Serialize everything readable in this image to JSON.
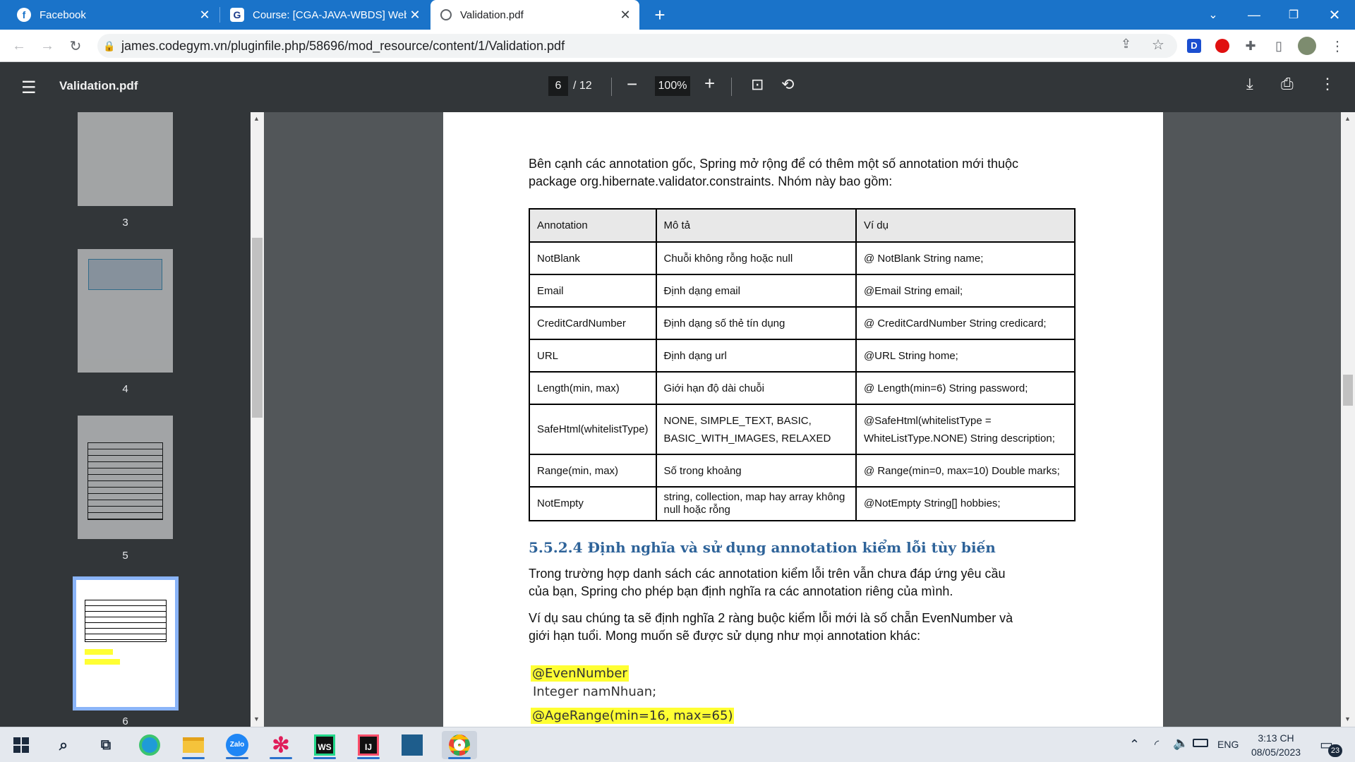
{
  "tabs": [
    {
      "title": "Facebook",
      "icon": "facebook-icon"
    },
    {
      "title": "Course: [CGA-JAVA-WBDS] Web |",
      "icon": "codegym-icon"
    },
    {
      "title": "Validation.pdf",
      "icon": "globe-icon"
    }
  ],
  "address": {
    "url": "james.codegym.vn/pluginfile.php/58696/mod_resource/content/1/Validation.pdf"
  },
  "pdf_toolbar": {
    "title": "Validation.pdf",
    "current_page": "6",
    "total_pages": "/ 12",
    "zoom": "100%"
  },
  "sidebar": {
    "thumbnails": [
      {
        "label": "3"
      },
      {
        "label": "4"
      },
      {
        "label": "5"
      },
      {
        "label": "6",
        "selected": true
      }
    ]
  },
  "document": {
    "intro_line1": "Bên cạnh các annotation gốc, Spring mở rộng để có thêm một số annotation mới thuộc",
    "intro_line2": "package org.hibernate.validator.constraints. Nhóm này bao gồm:",
    "table": {
      "headers": [
        "Annotation",
        "Mô tả",
        "Ví dụ"
      ],
      "rows": [
        {
          "annotation": "NotBlank",
          "desc": "Chuỗi không rỗng hoặc null",
          "example": "@ NotBlank String name;"
        },
        {
          "annotation": "Email",
          "desc": "Định dạng email",
          "example": "@Email String email;"
        },
        {
          "annotation": "CreditCardNumber",
          "desc": "Định dạng số thẻ tín dụng",
          "example": "@ CreditCardNumber String credicard;"
        },
        {
          "annotation": "URL",
          "desc": "Định dạng url",
          "example": "@URL String home;"
        },
        {
          "annotation": "Length(min, max)",
          "desc": "Giới hạn độ dài chuỗi",
          "example": "@ Length(min=6) String password;"
        },
        {
          "annotation": "SafeHtml(whitelistType)",
          "desc": "NONE, SIMPLE_TEXT, BASIC, BASIC_WITH_IMAGES, RELAXED",
          "example": "@SafeHtml(whitelistType = WhiteListType.NONE) String description;"
        },
        {
          "annotation": "Range(min, max)",
          "desc": "Số trong khoảng",
          "example": "@ Range(min=0, max=10) Double marks;"
        },
        {
          "annotation": "NotEmpty",
          "desc": "string, collection, map hay array không null hoặc rỗng",
          "example": "@NotEmpty String[] hobbies;"
        }
      ]
    },
    "section_heading": "5.5.2.4 Định nghĩa và sử dụng annotation kiểm lỗi tùy biến",
    "para1_line1": "Trong trường hợp danh sách các annotation kiểm lỗi trên vẫn chưa đáp ứng yêu cầu",
    "para1_line2": "của bạn, Spring cho phép bạn định nghĩa ra các annotation riêng của mình.",
    "para2_line1": "Ví dụ sau chúng ta sẽ định nghĩa 2 ràng buộc kiểm lỗi mới là số chẵn EvenNumber và",
    "para2_line2": "giới hạn tuổi. Mong muốn sẽ được sử dụng như mọi annotation khác:",
    "code1_annotation": "@EvenNumber",
    "code1_field": "Integer namNhuan;",
    "code2_annotation": "@AgeRange(min=16, max=65)"
  },
  "taskbar": {
    "apps": [
      "windows-start-icon",
      "search-icon",
      "task-view-icon",
      "edge-icon",
      "file-explorer-icon",
      "zalo-icon",
      "slack-icon",
      "webstorm-icon",
      "intellij-icon",
      "mysql-workbench-icon",
      "chrome-icon"
    ],
    "zalo_label": "Zalo",
    "ws_label": "WS",
    "ij_label": "IJ",
    "language": "ENG",
    "time": "3:13 CH",
    "date": "08/05/2023",
    "notifications": "23"
  },
  "colors": {
    "tabstrip": "#1a73c9",
    "pdf_toolbar": "#323639",
    "viewer_bg": "#525659",
    "heading_blue": "#2e6399",
    "highlight": "#ffff33"
  }
}
